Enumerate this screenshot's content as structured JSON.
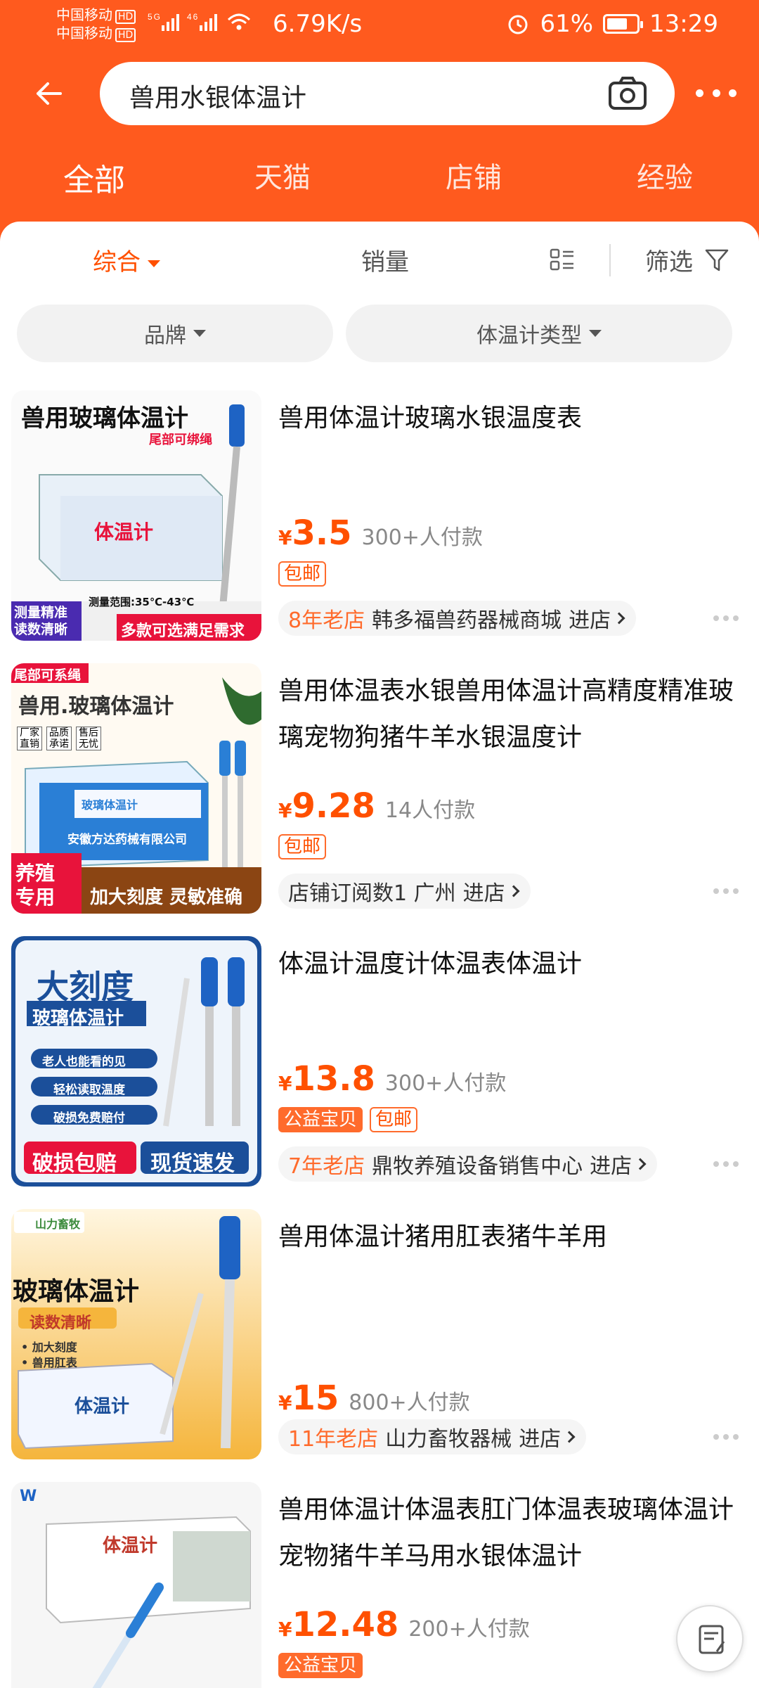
{
  "status_bar": {
    "carrier1": "中国移动",
    "carrier2": "中国移动",
    "hd": "HD",
    "signal_text": "5G 46",
    "net_speed": "6.79K/s",
    "battery": "61%",
    "battery_level": 0.61,
    "time": "13:29"
  },
  "search": {
    "query": "兽用水银体温计"
  },
  "tabs": [
    {
      "label": "全部"
    },
    {
      "label": "天猫"
    },
    {
      "label": "店铺"
    },
    {
      "label": "经验"
    }
  ],
  "sort": {
    "comprehensive": "综合",
    "sales": "销量",
    "filter": "筛选"
  },
  "chips": [
    {
      "label": "品牌"
    },
    {
      "label": "体温计类型"
    }
  ],
  "products": [
    {
      "title": "兽用体温计玻璃水银温度表",
      "price": "3.5",
      "sales": "300+人付款",
      "tags": [
        "包邮"
      ],
      "shop_age": "8年老店",
      "shop_name": "韩多福兽药器械商城",
      "enter": "进店",
      "thumb": {
        "line1": "兽用玻璃体温计",
        "line2": "尾部可绑绳",
        "line3": "测量范围:35℃-43℃",
        "badge1": "测量精准",
        "badge2": "读数清晰",
        "banner": "多款可选满足需求",
        "box": "体温计"
      }
    },
    {
      "title": "兽用体温表水银兽用体温计高精度精准玻璃宠物狗猪牛羊水银温度计",
      "price": "9.28",
      "sales": "14人付款",
      "tags": [
        "包邮"
      ],
      "shop_age": "",
      "shop_name": "店铺订阅数1 广州",
      "enter": "进店",
      "thumb": {
        "corner": "尾部可系绳",
        "line1": "兽用.玻璃体温计",
        "b1": "厂家直销",
        "b2": "品质承诺",
        "b3": "售后无忧",
        "box1": "玻璃体温计",
        "box2": "安徽方达药械有限公司",
        "badge": "养殖专用",
        "banner": "加大刻度 灵敏准确"
      }
    },
    {
      "title": "体温计温度计体温表体温计",
      "price": "13.8",
      "sales": "300+人付款",
      "tags": [
        "公益宝贝",
        "包邮"
      ],
      "shop_age": "7年老店",
      "shop_name": "鼎牧养殖设备销售中心",
      "enter": "进店",
      "thumb": {
        "line1": "大刻度",
        "line2": "玻璃体温计",
        "f1": "老人也能看的见",
        "f2": "轻松读取温度",
        "f3": "破损免费赔付",
        "b1": "破损包赔",
        "b2": "现货速发"
      }
    },
    {
      "title": "兽用体温计猪用肛表猪牛羊用",
      "price": "15",
      "sales": "800+人付款",
      "tags": [],
      "shop_age": "11年老店",
      "shop_name": "山力畜牧器械",
      "enter": "进店",
      "thumb": {
        "logo": "山力畜牧",
        "line1": "玻璃体温计",
        "line2": "读数清晰",
        "f1": "• 加大刻度",
        "f2": "• 兽用肛表",
        "box": "体温计"
      }
    },
    {
      "title": "兽用体温计体温表肛门体温表玻璃体温计宠物猪牛羊马用水银体温计",
      "price": "12.48",
      "sales": "200+人付款",
      "tags": [
        "公益宝贝"
      ],
      "shop_age": "",
      "shop_name": "",
      "enter": "",
      "thumb": {
        "logo": "W",
        "box": "体温计"
      }
    }
  ],
  "colors": {
    "brand": "#ff5a1e",
    "price": "#ff5000"
  }
}
